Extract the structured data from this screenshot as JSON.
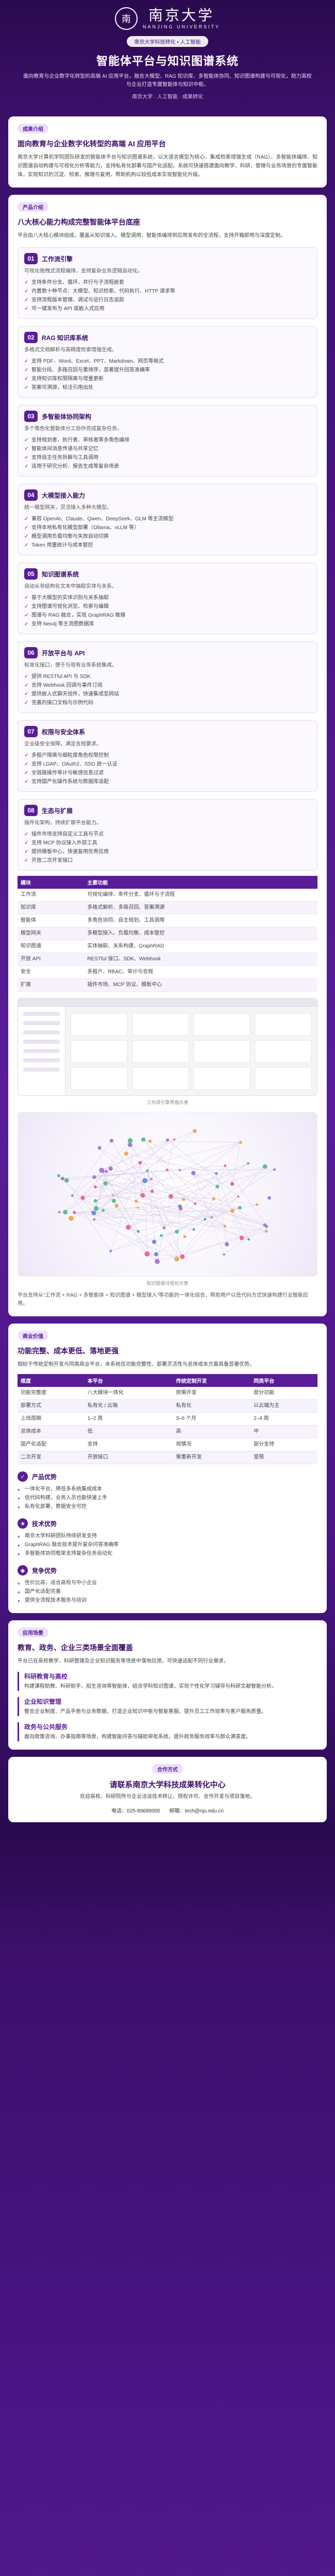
{
  "header": {
    "emblem": "南",
    "university_cn": "南京大学",
    "university_en": "NANJING UNIVERSITY",
    "pill": "南京大学科技转化 • 人工智能",
    "title": "智能体平台与知识图谱系统",
    "desc": "面向教育与企业数字化转型的高端 AI 应用平台，融合大模型、RAG 知识库、多智能体协同、知识图谱构建与可视化，助力高校与企业打造专属智能体与知识中枢。",
    "meta": "南京大学 · 人工智能 · 成果转化"
  },
  "intro": {
    "tag": "成果介绍",
    "title": "面向教育与企业数字化转型的高端 AI 应用平台",
    "body": "南京大学计算机学院团队研发的智能体平台与知识图谱系统，以大语言模型为核心，集成检索增强生成（RAG）、多智能体编排、知识图谱自动构建与可视化分析等能力，支持私有化部署与国产化适配。系统可快速搭建面向教学、科研、管理与业务场景的专属智能体，实现知识的沉淀、检索、推理与复用，帮助机构以较低成本实现智能化升级。"
  },
  "product": {
    "tag": "产品介绍",
    "title": "八大核心能力构成完整智能体平台底座",
    "body": "平台由八大核心模块组成，覆盖从知识接入、模型调用、智能体编排到应用发布的全流程，支持开箱即用与深度定制。",
    "modules": [
      {
        "num": "01",
        "title": "工作流引擎",
        "desc": "可视化拖拽式流程编排，支持复杂业务逻辑自动化。",
        "items": [
          "支持条件分支、循环、并行与子流程嵌套",
          "内置数十种节点：大模型、知识检索、代码执行、HTTP 请求等",
          "支持流程版本管理、调试与运行日志追踪",
          "可一键发布为 API 或嵌入式应用"
        ]
      },
      {
        "num": "02",
        "title": "RAG 知识库系统",
        "desc": "多格式文档解析与高精度检索增强生成。",
        "items": [
          "支持 PDF、Word、Excel、PPT、Markdown、网页等格式",
          "智能分段、多路召回与重排序，显著提升回答准确率",
          "支持知识库权限隔离与增量更新",
          "答案可溯源，标注引用出处"
        ]
      },
      {
        "num": "03",
        "title": "多智能体协同架构",
        "desc": "多个角色化智能体分工协作完成复杂任务。",
        "items": [
          "支持规划者、执行者、审核者等多角色编排",
          "智能体间消息传递与共享记忆",
          "支持自主任务拆解与工具调用",
          "适用于研究分析、报告生成等复杂场景"
        ]
      },
      {
        "num": "04",
        "title": "大模型接入能力",
        "desc": "统一模型网关，灵活接入多种大模型。",
        "items": [
          "兼容 OpenAI、Claude、Qwen、DeepSeek、GLM 等主流模型",
          "支持本地私有化模型部署（Ollama、vLLM 等）",
          "模型调用负载均衡与失败自动切换",
          "Token 用量统计与成本管控"
        ]
      },
      {
        "num": "05",
        "title": "知识图谱系统",
        "desc": "自动从非结构化文本中抽取实体与关系。",
        "items": [
          "基于大模型的实体识别与关系抽取",
          "支持图谱可视化浏览、检索与编辑",
          "图谱与 RAG 融合，实现 GraphRAG 推理",
          "支持 Neo4j 等主流图数据库"
        ]
      },
      {
        "num": "06",
        "title": "开放平台与 API",
        "desc": "标准化接口，便于与现有业务系统集成。",
        "items": [
          "提供 RESTful API 与 SDK",
          "支持 Webhook 回调与事件订阅",
          "提供嵌入式聊天组件，快速集成至网站",
          "完善的接口文档与示例代码"
        ]
      },
      {
        "num": "07",
        "title": "权限与安全体系",
        "desc": "企业级安全保障，满足合规要求。",
        "items": [
          "多租户隔离与细粒度角色权限控制",
          "支持 LDAP、OAuth2、SSO 统一认证",
          "全链路操作审计与敏感信息过滤",
          "支持国产化操作系统与数据库适配"
        ]
      },
      {
        "num": "08",
        "title": "生态与扩展",
        "desc": "插件化架构，持续扩展平台能力。",
        "items": [
          "插件市场支持自定义工具与节点",
          "支持 MCP 协议接入外部工具",
          "提供模板中心，快速复用优秀应用",
          "开放二次开发接口"
        ]
      }
    ],
    "table": {
      "headers": [
        "模块",
        "主要功能"
      ],
      "rows": [
        [
          "工作流",
          "可视化编排、条件分支、循环与子流程"
        ],
        [
          "知识库",
          "多格式解析、多路召回、答案溯源"
        ],
        [
          "智能体",
          "多角色协同、自主规划、工具调用"
        ],
        [
          "模型网关",
          "多模型接入、负载均衡、成本管控"
        ],
        [
          "知识图谱",
          "实体抽取、关系构建、GraphRAG"
        ],
        [
          "开放 API",
          "RESTful 接口、SDK、Webhook"
        ],
        [
          "安全",
          "多租户、RBAC、审计与合规"
        ],
        [
          "扩展",
          "插件市场、MCP 协议、模板中心"
        ]
      ]
    },
    "shot_caption": "工作流引擎界面示意",
    "graph_caption": "知识图谱可视化示意",
    "note": "平台支持从“工作流 + RAG + 多智能体 + 知识图谱 + 模型接入”等功能的一体化组合，帮助用户以低代码方式快速构建行业智能应用。"
  },
  "value": {
    "tag": "商业价值",
    "title": "功能完整、成本更低、落地更强",
    "body": "相较于传统定制开发与同类商业平台，本系统在功能完整性、部署灵活性与总体成本方面具备显著优势。",
    "table": {
      "headers": [
        "维度",
        "本平台",
        "传统定制开发",
        "同类平台"
      ],
      "rows": [
        [
          "功能完整度",
          "八大模块一体化",
          "按需开发",
          "部分功能"
        ],
        [
          "部署方式",
          "私有化 / 云端",
          "私有化",
          "以云端为主"
        ],
        [
          "上线周期",
          "1–2 周",
          "3–6 个月",
          "2–4 周"
        ],
        [
          "总体成本",
          "低",
          "高",
          "中"
        ],
        [
          "国产化适配",
          "支持",
          "视情况",
          "部分支持"
        ],
        [
          "二次开发",
          "开放接口",
          "需重新开发",
          "受限"
        ]
      ]
    },
    "points": [
      {
        "icon": "✓",
        "title": "产品优势",
        "items": [
          "一体化平台，降低多系统集成成本",
          "低代码构建，业务人员也能快速上手",
          "私有化部署，数据安全可控"
        ]
      },
      {
        "icon": "★",
        "title": "技术优势",
        "items": [
          "南京大学科研团队持续研发支持",
          "GraphRAG 融合技术提升复杂问答准确率",
          "多智能体协同框架支持复杂任务自动化"
        ]
      },
      {
        "icon": "◆",
        "title": "竞争优势",
        "items": [
          "性价比高，适合高校与中小企业",
          "国产化适配完善",
          "提供全流程技术服务与培训"
        ]
      }
    ]
  },
  "scenarios": {
    "tag": "应用场景",
    "title": "教育、政务、企业三类场景全面覆盖",
    "body": "平台已在高校教学、科研管理及企业知识服务等场景中落地应用，可快速适配不同行业需求。",
    "list": [
      {
        "title": "科研教育与高校",
        "text": "构建课程助教、科研助手、招生咨询等智能体，结合学科知识图谱，实现个性化学习辅导与科研文献智能分析。"
      },
      {
        "title": "企业知识管理",
        "text": "整合企业制度、产品手册与业务数据，打造企业知识中枢与智能客服，提升员工工作效率与客户服务质量。"
      },
      {
        "title": "政务与公共服务",
        "text": "面向政策咨询、办事指南等场景，构建智能问答与辅助审批系统，提升政务服务效率与群众满意度。"
      }
    ]
  },
  "contact": {
    "tag": "合作方式",
    "title": "请联系南京大学科技成果转化中心",
    "line": "欢迎高校、科研院所与企业洽谈技术转让、授权许可、合作开发与项目落地。",
    "phone_label": "电话：",
    "phone": "025-89680000",
    "email_label": "邮箱：",
    "email": "tech@nju.edu.cn"
  }
}
